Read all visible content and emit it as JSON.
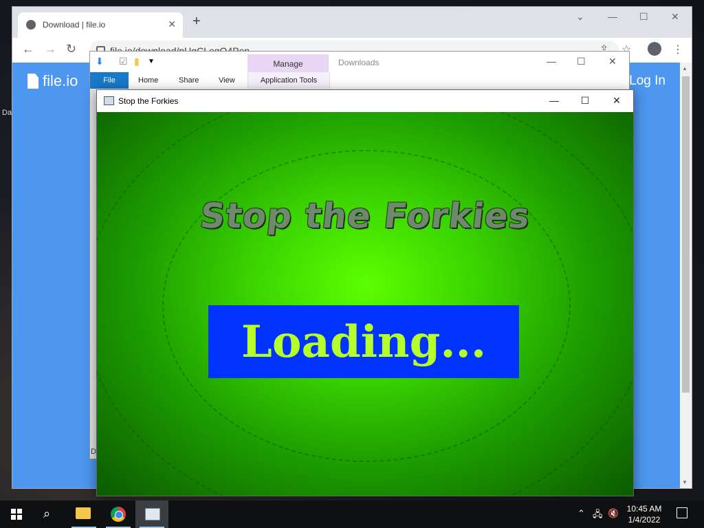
{
  "desktop": {
    "labels": [
      "Da"
    ]
  },
  "chrome": {
    "tab_title": "Download | file.io",
    "new_tab": "+",
    "url": "file.io/download/pUgCLeqO4Pen",
    "page": {
      "logo": "file.io",
      "login": "Log In",
      "help": "?"
    }
  },
  "explorer": {
    "manage": "Manage",
    "folder_title": "Downloads",
    "tabs": {
      "file": "File",
      "home": "Home",
      "share": "Share",
      "view": "View",
      "app_tools": "Application Tools"
    },
    "bottom_letter": "D"
  },
  "game": {
    "title": "Stop the Forkies",
    "logo_text": "Stop the Forkies",
    "loading_text": "Loading..."
  },
  "taskbar": {
    "time": "10:45 AM",
    "date": "1/4/2022"
  }
}
